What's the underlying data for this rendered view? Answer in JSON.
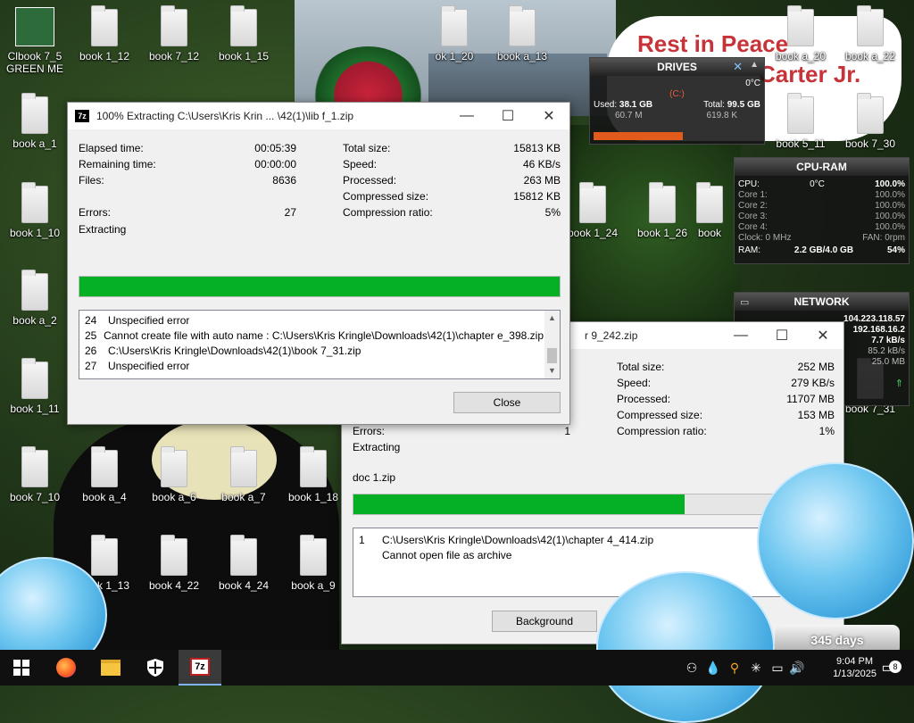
{
  "desktop": {
    "icons": [
      {
        "label": "Clbook 7_5"
      },
      {
        "label": "book 1_12"
      },
      {
        "label": "book 7_12"
      },
      {
        "label": "book 1_15"
      },
      {
        "label": "ok 1_20"
      },
      {
        "label": "book a_13"
      },
      {
        "label": "book a_20"
      },
      {
        "label": "book a_22"
      },
      {
        "label": "book a_1"
      },
      {
        "label": "book 5_11"
      },
      {
        "label": "book 7_30"
      },
      {
        "label": "book 1_10"
      },
      {
        "label": "book 1_24"
      },
      {
        "label": "book 1_26"
      },
      {
        "label": "book"
      },
      {
        "label": "book a_2"
      },
      {
        "label": "book 1_11"
      },
      {
        "label": "book 7_31"
      },
      {
        "label": "book 7_10"
      },
      {
        "label": "book a_4"
      },
      {
        "label": "book a_6"
      },
      {
        "label": "book a_7"
      },
      {
        "label": "book 1_18"
      },
      {
        "label": "book 1_13"
      },
      {
        "label": "book 4_22"
      },
      {
        "label": "book 4_24"
      },
      {
        "label": "book a_9"
      }
    ],
    "green_me_label": "GREEN ME",
    "memorial_title": "Rest in Peace",
    "memorial_name": "Carter Jr.",
    "snow_globe_days": "345 days"
  },
  "drives_widget": {
    "title": "DRIVES",
    "temp": "0°C",
    "drive": "(C:)",
    "used_label": "Used:",
    "used_value": "38.1 GB",
    "total_label": "Total:",
    "total_value": "99.5 GB",
    "read_rate": "60.7 M",
    "write_rate": "619.8 K"
  },
  "cpu_widget": {
    "title": "CPU-RAM",
    "cpu_label": "CPU:",
    "cpu_temp": "0°C",
    "cpu_value": "100.0%",
    "cores": [
      {
        "label": "Core 1:",
        "value": "100.0%"
      },
      {
        "label": "Core 2:",
        "value": "100.0%"
      },
      {
        "label": "Core 3:",
        "value": "100.0%"
      },
      {
        "label": "Core 4:",
        "value": "100.0%"
      }
    ],
    "clock": "Clock: 0 MHz",
    "fan": "FAN: 0rpm",
    "ram_label": "RAM:",
    "ram_value": "2.2 GB/4.0 GB",
    "ram_percent": "54%"
  },
  "network_widget": {
    "title": "NETWORK",
    "external_ip": "104.223.118.57",
    "internal_ip": "192.168.16.2",
    "rate_total": "7.7 kB/s",
    "rate_up": "85.2 kB/s",
    "rate_down": "25.0 MB"
  },
  "dialog1": {
    "title": "100% Extracting C:\\Users\\Kris Krin ... \\42(1)\\lib f_1.zip",
    "elapsed_label": "Elapsed time:",
    "elapsed_value": "00:05:39",
    "remaining_label": "Remaining time:",
    "remaining_value": "00:00:00",
    "files_label": "Files:",
    "files_value": "8636",
    "errors_label": "Errors:",
    "errors_value": "27",
    "status": "Extracting",
    "total_size_label": "Total size:",
    "total_size_value": "15813 KB",
    "speed_label": "Speed:",
    "speed_value": "46 KB/s",
    "processed_label": "Processed:",
    "processed_value": "263 MB",
    "compressed_label": "Compressed size:",
    "compressed_value": "15812 KB",
    "ratio_label": "Compression ratio:",
    "ratio_value": "5%",
    "progress_percent": 100,
    "log": [
      {
        "n": "24",
        "text": "Unspecified error"
      },
      {
        "n": "25",
        "text": "Cannot create file with auto name : C:\\Users\\Kris Kringle\\Downloads\\42(1)\\chapter e_398.zip"
      },
      {
        "n": "26",
        "text": "C:\\Users\\Kris Kringle\\Downloads\\42(1)\\book 7_31.zip"
      },
      {
        "n": "27",
        "text": "Unspecified error"
      }
    ],
    "close_label": "Close"
  },
  "dialog2": {
    "title_fragment": "r 9_242.zip",
    "errors_label": "Errors:",
    "errors_value": "1",
    "status": "Extracting",
    "current_file": "doc 1.zip",
    "total_size_label": "Total size:",
    "total_size_value": "252 MB",
    "speed_label": "Speed:",
    "speed_value": "279 KB/s",
    "processed_label": "Processed:",
    "processed_value": "11707 MB",
    "compressed_label": "Compressed size:",
    "compressed_value": "153 MB",
    "ratio_label": "Compression ratio:",
    "ratio_value": "1%",
    "progress_percent": 69,
    "log": [
      {
        "n": "1",
        "text": "C:\\Users\\Kris Kringle\\Downloads\\42(1)\\chapter 4_414.zip"
      },
      {
        "n": "",
        "text": "Cannot open file as archive"
      }
    ],
    "background_label": "Background"
  },
  "taskbar": {
    "time": "9:04 PM",
    "date": "1/13/2025",
    "notification_count": "8",
    "app_7z": "7z"
  }
}
